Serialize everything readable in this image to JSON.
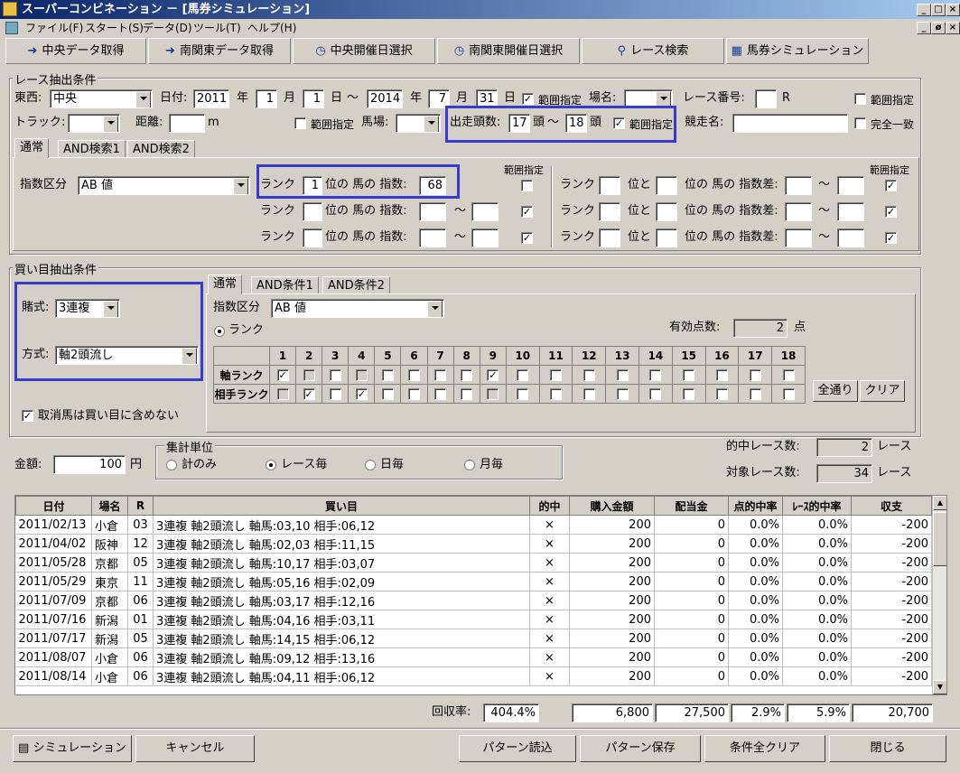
{
  "window": {
    "title": "スーパーコンビネーション － [馬券シミュレーション]",
    "min": "_",
    "max": "□",
    "close": "×",
    "min2": "_",
    "restore": "ø",
    "close2": "×"
  },
  "menu": [
    "ファイル(F)",
    "スタート(S)",
    "データ(D)",
    "ツール(T)",
    "ヘルプ(H)"
  ],
  "toolbar": [
    "中央データ取得",
    "南関東データ取得",
    "中央開催日選択",
    "南関東開催日選択",
    "レース検索",
    "馬券シミュレーション"
  ],
  "race": {
    "group_title": "レース抽出条件",
    "east_west_label": "東西:",
    "east_west": "中央",
    "date_label": "日付:",
    "y1": "2011",
    "y_unit": "年",
    "m1": "1",
    "m_unit": "月",
    "d1": "1",
    "d_unit": "日",
    "tilde": "～",
    "y2": "2014",
    "m2": "7",
    "d2": "31",
    "range_label": "範囲指定",
    "place_label": "場名:",
    "raceno_label": "レース番号:",
    "r_unit": "R",
    "track_label": "トラック:",
    "distance_label": "距離:",
    "m_label": "m",
    "baba_label": "馬場:",
    "runners_label": "出走頭数:",
    "runners_from": "17",
    "runners_to": "18",
    "tou": "頭",
    "racename_label": "競走名:",
    "exact_label": "完全一致",
    "tabs": [
      "通常",
      "AND検索1",
      "AND検索2"
    ],
    "index_label": "指数区分",
    "index_value": "AB 値",
    "rank": "ランク",
    "pos_label": "位の 馬の 指数:",
    "rank1": "1",
    "idx1": "68",
    "range_hdr": "範囲指定",
    "pos_and": "位と",
    "diff_label": "位の 馬の 指数差:"
  },
  "bet": {
    "group_title": "買い目抽出条件",
    "type_label": "賭式:",
    "type_value": "3連複",
    "method_label": "方式:",
    "method_value": "軸2頭流し",
    "exclude_label": "取消馬は買い目に含めない",
    "tabs": [
      "通常",
      "AND条件1",
      "AND条件2"
    ],
    "index_label": "指数区分",
    "index_value": "AB 値",
    "rank_radio": "ランク",
    "valid_label": "有効点数:",
    "valid_count": "2",
    "ten": "点",
    "cols": [
      "1",
      "2",
      "3",
      "4",
      "5",
      "6",
      "7",
      "8",
      "9",
      "10",
      "11",
      "12",
      "13",
      "14",
      "15",
      "16",
      "17",
      "18"
    ],
    "axis_label": "軸ランク",
    "partner_label": "相手ランク",
    "all_btn": "全通り",
    "clear_btn": "クリア"
  },
  "amount": {
    "label": "金額:",
    "value": "100",
    "unit": "円"
  },
  "agg": {
    "title": "集計単位",
    "opts": [
      "計のみ",
      "レース毎",
      "日毎",
      "月毎"
    ]
  },
  "stats": {
    "hit_label": "的中レース数:",
    "hit": "2",
    "target_label": "対象レース数:",
    "target": "34",
    "unit": "レース"
  },
  "results": {
    "headers": [
      "日付",
      "場名",
      "R",
      "買い目",
      "的中",
      "購入金額",
      "配当金",
      "点的中率",
      "ﾚｰｽ的中率",
      "収支"
    ],
    "rows": [
      [
        "2011/02/13",
        "小倉",
        "03",
        "3連複 軸2頭流し 軸馬:03,10 相手:06,12",
        "×",
        "200",
        "0",
        "0.0%",
        "0.0%",
        "-200"
      ],
      [
        "2011/04/02",
        "阪神",
        "12",
        "3連複 軸2頭流し 軸馬:02,03 相手:11,15",
        "×",
        "200",
        "0",
        "0.0%",
        "0.0%",
        "-200"
      ],
      [
        "2011/05/28",
        "京都",
        "05",
        "3連複 軸2頭流し 軸馬:10,17 相手:03,07",
        "×",
        "200",
        "0",
        "0.0%",
        "0.0%",
        "-200"
      ],
      [
        "2011/05/29",
        "東京",
        "11",
        "3連複 軸2頭流し 軸馬:05,16 相手:02,09",
        "×",
        "200",
        "0",
        "0.0%",
        "0.0%",
        "-200"
      ],
      [
        "2011/07/09",
        "京都",
        "06",
        "3連複 軸2頭流し 軸馬:03,17 相手:12,16",
        "×",
        "200",
        "0",
        "0.0%",
        "0.0%",
        "-200"
      ],
      [
        "2011/07/16",
        "新潟",
        "01",
        "3連複 軸2頭流し 軸馬:04,16 相手:03,11",
        "×",
        "200",
        "0",
        "0.0%",
        "0.0%",
        "-200"
      ],
      [
        "2011/07/17",
        "新潟",
        "05",
        "3連複 軸2頭流し 軸馬:14,15 相手:06,12",
        "×",
        "200",
        "0",
        "0.0%",
        "0.0%",
        "-200"
      ],
      [
        "2011/08/07",
        "小倉",
        "06",
        "3連複 軸2頭流し 軸馬:09,12 相手:13,16",
        "×",
        "200",
        "0",
        "0.0%",
        "0.0%",
        "-200"
      ],
      [
        "2011/08/14",
        "小倉",
        "06",
        "3連複 軸2頭流し 軸馬:04,11 相手:06,12",
        "×",
        "200",
        "0",
        "0.0%",
        "0.0%",
        "-200"
      ]
    ]
  },
  "totals": {
    "label": "回収率:",
    "rate": "404.4%",
    "purchase": "6,800",
    "payout": "27,500",
    "pt_rate": "2.9%",
    "race_rate": "5.9%",
    "balance": "20,700"
  },
  "bottom": [
    "シミュレーション",
    "キャンセル",
    "パターン読込",
    "パターン保存",
    "条件全クリア",
    "閉じる"
  ]
}
